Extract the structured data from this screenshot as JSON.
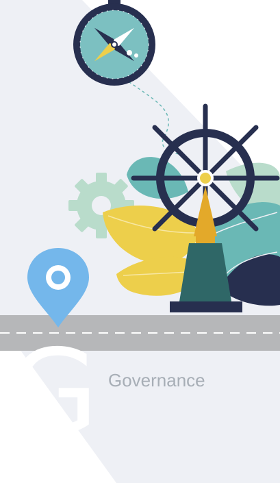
{
  "caption": "Governance",
  "letter": "G",
  "icons": [
    "compass-icon",
    "ship-wheel-icon",
    "gear-icon",
    "map-pin-icon",
    "leaf-icon"
  ],
  "colors": {
    "panel": "#eef0f5",
    "road": "#b6b7b9",
    "navy": "#272f4f",
    "teal": "#6ab8b5",
    "yellow": "#edcf4b",
    "pin": "#74b7eb",
    "gear": "#b9dccb",
    "caption": "#a7aeb6"
  }
}
